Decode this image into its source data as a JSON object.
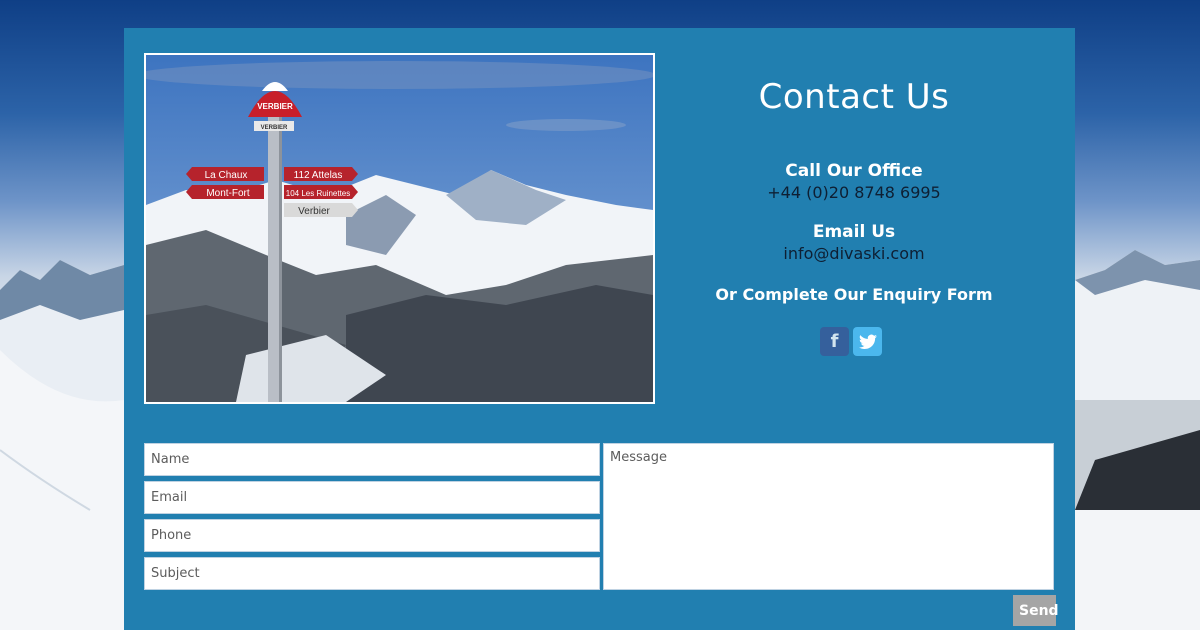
{
  "photo": {
    "sign_top": "VERBIER",
    "sign_small": "VERBIER",
    "signs_left": [
      "La Chaux",
      "Mont-Fort"
    ],
    "signs_right": [
      "112 Attelas",
      "104 Les Ruinettes",
      "Verbier"
    ]
  },
  "contact": {
    "title": "Contact Us",
    "office_label": "Call Our Office",
    "office_phone": "+44 (0)20 8748 6995",
    "email_label": "Email Us",
    "email_value": "info@divaski.com",
    "enquiry_text": "Or Complete Our Enquiry Form"
  },
  "social": {
    "facebook_glyph": "f",
    "twitter_glyph": "🐦"
  },
  "form": {
    "name_placeholder": "Name",
    "email_placeholder": "Email",
    "phone_placeholder": "Phone",
    "subject_placeholder": "Subject",
    "message_placeholder": "Message",
    "send_label": "Send"
  },
  "colors": {
    "panel": "#217fb0",
    "facebook": "#3b5998",
    "twitter": "#4bb7ed",
    "send": "#a5a5a5"
  }
}
